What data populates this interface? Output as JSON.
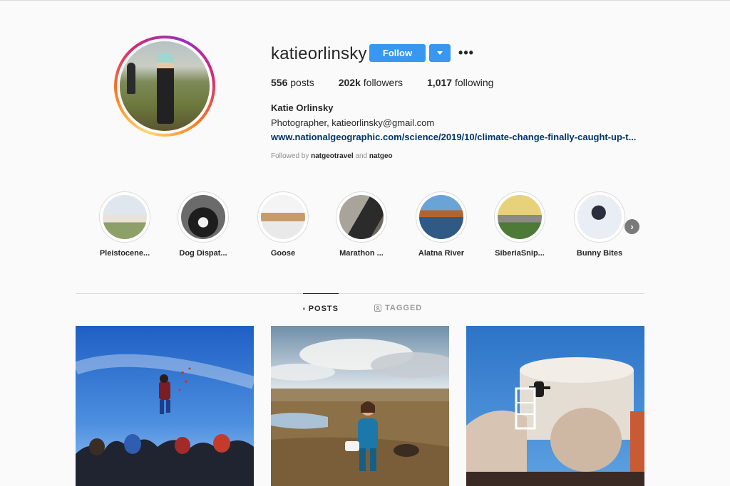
{
  "profile": {
    "username": "katieorlinsky",
    "follow_label": "Follow",
    "more_label": "•••",
    "stats": {
      "posts_count": "556",
      "posts_label": " posts",
      "followers_count": "202k",
      "followers_label": " followers",
      "following_count": "1,017",
      "following_label": " following"
    },
    "full_name": "Katie Orlinsky",
    "bio": "Photographer, katieorlinsky@gmail.com",
    "link": "www.nationalgeographic.com/science/2019/10/climate-change-finally-caught-up-t...",
    "followed_by": {
      "prefix": "Followed by ",
      "user1": "natgeotravel",
      "middle": " and ",
      "user2": "natgeo"
    }
  },
  "highlights": [
    {
      "label": "Pleistocene..."
    },
    {
      "label": "Dog Dispat..."
    },
    {
      "label": "Goose"
    },
    {
      "label": "Marathon ..."
    },
    {
      "label": "Alatna River"
    },
    {
      "label": "SiberiaSnip..."
    },
    {
      "label": "Bunny Bites"
    }
  ],
  "highlights_next_icon": "chevron-right-icon",
  "tabs": [
    {
      "label": "POSTS",
      "icon": "grid-icon",
      "active": true
    },
    {
      "label": "TAGGED",
      "icon": "tag-icon",
      "active": false
    }
  ],
  "colors": {
    "follow_button": "#3897f0",
    "link": "#003569",
    "background": "#fafafa"
  }
}
